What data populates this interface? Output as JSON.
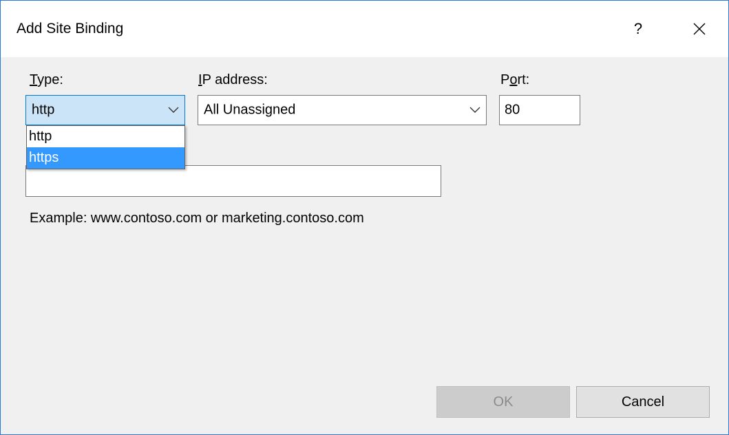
{
  "window": {
    "title": "Add Site Binding",
    "help_label": "?",
    "close_icon": "close-icon"
  },
  "type": {
    "label_accel": "T",
    "label_rest": "ype:",
    "selected": "http",
    "options": [
      "http",
      "https"
    ],
    "highlighted": "https"
  },
  "ip": {
    "label_accel": "I",
    "label_rest": "P address:",
    "selected": "All Unassigned"
  },
  "port": {
    "label_before": "P",
    "label_accel": "o",
    "label_after": "rt:",
    "value": "80"
  },
  "host": {
    "value": "",
    "example": "Example: www.contoso.com or marketing.contoso.com"
  },
  "buttons": {
    "ok": "OK",
    "cancel": "Cancel"
  },
  "colors": {
    "accent": "#0078d7",
    "highlight": "#3399ff",
    "dialog_bg": "#f0f0f0"
  }
}
